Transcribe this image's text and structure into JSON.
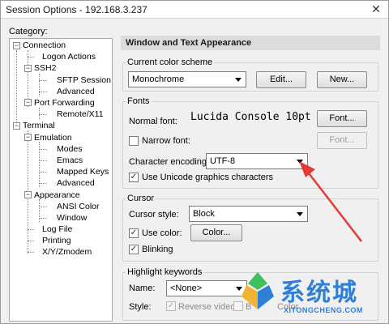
{
  "window": {
    "title": "Session Options - 192.168.3.237",
    "close_glyph": "✕"
  },
  "sidebar": {
    "label": "Category:",
    "items": [
      {
        "label": "Connection"
      },
      {
        "label": "Logon Actions"
      },
      {
        "label": "SSH2"
      },
      {
        "label": "SFTP Session"
      },
      {
        "label": "Advanced"
      },
      {
        "label": "Port Forwarding"
      },
      {
        "label": "Remote/X11"
      },
      {
        "label": "Terminal"
      },
      {
        "label": "Emulation"
      },
      {
        "label": "Modes"
      },
      {
        "label": "Emacs"
      },
      {
        "label": "Mapped Keys"
      },
      {
        "label": "Advanced"
      },
      {
        "label": "Appearance"
      },
      {
        "label": "ANSI Color"
      },
      {
        "label": "Window"
      },
      {
        "label": "Log File"
      },
      {
        "label": "Printing"
      },
      {
        "label": "X/Y/Zmodem"
      }
    ],
    "expander_glyph": "−"
  },
  "panel": {
    "heading": "Window and Text Appearance",
    "color_scheme": {
      "group_label": "Current color scheme",
      "value": "Monochrome",
      "edit_label": "Edit...",
      "new_label": "New..."
    },
    "fonts": {
      "group_label": "Fonts",
      "normal_font_label": "Normal font:",
      "normal_font_value": "Lucida Console 10pt",
      "font_button_label": "Font...",
      "narrow_font_label": "Narrow font:",
      "narrow_font_checked": false,
      "narrow_font_button_label": "Font...",
      "encoding_label": "Character encoding:",
      "encoding_value": "UTF-8",
      "unicode_graphics_label": "Use Unicode graphics characters",
      "unicode_graphics_checked": true
    },
    "cursor": {
      "group_label": "Cursor",
      "style_label": "Cursor style:",
      "style_value": "Block",
      "use_color_label": "Use color:",
      "use_color_checked": true,
      "color_button_label": "Color...",
      "blinking_label": "Blinking",
      "blinking_checked": true
    },
    "highlight": {
      "group_label": "Highlight keywords",
      "name_label": "Name:",
      "name_value": "<None>",
      "style_label": "Style:",
      "reverse_video_label": "Reverse video",
      "reverse_video_checked": true,
      "bold_label": "B",
      "color_label": "Color"
    }
  },
  "annotation": {
    "arrow_color": "#e53935"
  },
  "watermark": {
    "text": "系统城",
    "subtext": "XITONGCHENG.COM",
    "color": "#2f7fd6"
  },
  "checkmark_glyph": "✓"
}
